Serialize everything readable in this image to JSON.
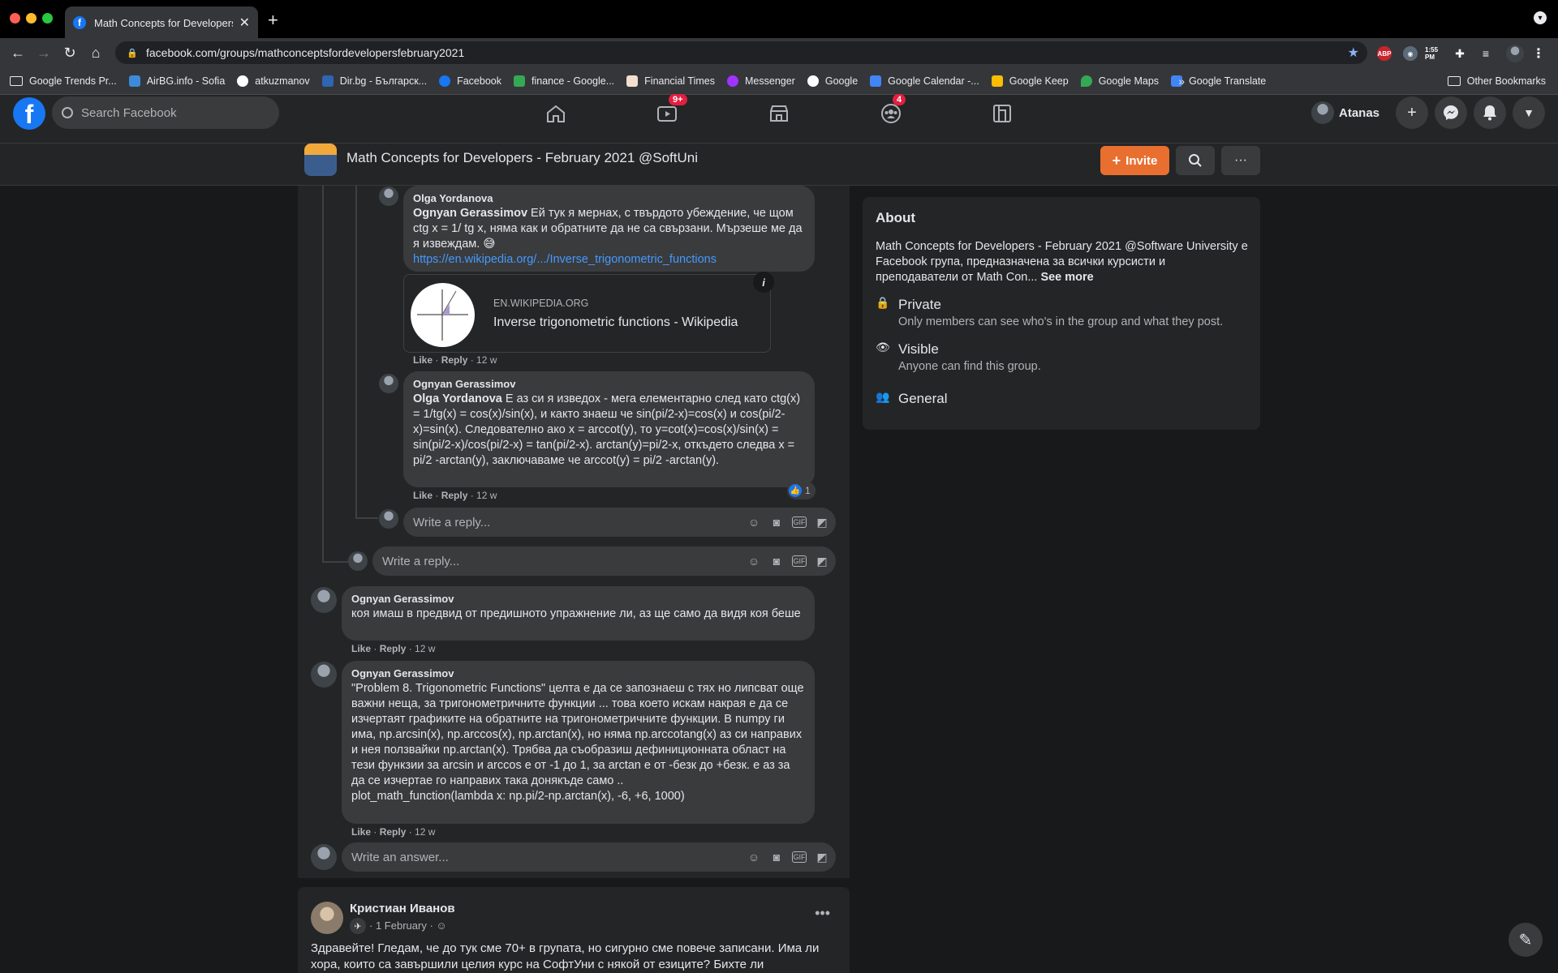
{
  "browser": {
    "tab_title": "Math Concepts for Developers",
    "url": "facebook.com/groups/mathconceptsfordevelopersfebruary2021",
    "clock": "1:55 PM",
    "bookmarks": [
      {
        "label": "Google Trends Pr...",
        "color": "#f4b400"
      },
      {
        "label": "AirBG.info - Sofia",
        "color": "#3b8bd8"
      },
      {
        "label": "atkuzmanov",
        "color": "#ffffff"
      },
      {
        "label": "Dir.bg - Българск...",
        "color": "#2f66b3"
      },
      {
        "label": "Facebook",
        "color": "#1877f2"
      },
      {
        "label": "finance - Google...",
        "color": "#34a853"
      },
      {
        "label": "Financial Times",
        "color": "#f2dfce"
      },
      {
        "label": "Messenger",
        "color": "#a033ff"
      },
      {
        "label": "Google",
        "color": "#ffffff"
      },
      {
        "label": "Google Calendar -...",
        "color": "#4285f4"
      },
      {
        "label": "Google Keep",
        "color": "#fbbc04"
      },
      {
        "label": "Google Maps",
        "color": "#34a853"
      },
      {
        "label": "Google Translate",
        "color": "#4285f4"
      }
    ],
    "more": "»",
    "other_bookmarks": "Other Bookmarks"
  },
  "fb": {
    "search_placeholder": "Search Facebook",
    "watch_badge": "9+",
    "groups_badge": "4",
    "profile_name": "Atanas"
  },
  "group": {
    "title": "Math Concepts for Developers - February 2021 @SoftUni",
    "invite_label": "Invite",
    "more_label": "···"
  },
  "comments": {
    "olga": {
      "author": "Olga Yordanova",
      "mention": "Ognyan Gerassimov",
      "text": " Ей тук я мернах, с твърдото убеждение, че щом ctg x = 1/ tg x, няма как и обратните да не са свързани. Мързеше ме да я извеждам. 😅",
      "link": "https://en.wikipedia.org/.../Inverse_trigonometric_functions",
      "preview_domain": "EN.WIKIPEDIA.ORG",
      "preview_title": "Inverse trigonometric functions - Wikipedia",
      "like": "Like",
      "reply": "Reply",
      "time": "12 w"
    },
    "ognyan1": {
      "author": "Ognyan Gerassimov",
      "mention": "Olga Yordanova",
      "text": " Е аз си я изведох - мега елементарно след като ctg(x) = 1/tg(x) = cos(x)/sin(x), и както знаеш че sin(pi/2-x)=cos(x) и cos(pi/2-x)=sin(x). Следователно ако x = arccot(y), то y=cot(x)=cos(x)/sin(x) = sin(pi/2-x)/cos(pi/2-x) = tan(pi/2-x). arctan(y)=pi/2-x, откъдето следва x = pi/2 -arctan(y), заключаваме че arccot(y) = pi/2 -arctan(y).",
      "like": "Like",
      "reply": "Reply",
      "time": "12 w",
      "reactions": "1"
    },
    "reply_placeholder": "Write a reply...",
    "ognyan2": {
      "author": "Ognyan Gerassimov",
      "text": "коя имаш в предвид от предишното упражнение ли, аз ще само да видя коя беше",
      "like": "Like",
      "reply": "Reply",
      "time": "12 w"
    },
    "ognyan3": {
      "author": "Ognyan Gerassimov",
      "text": "\"Problem 8. Trigonometric Functions\" целта е да се запознаеш с тях но липсват още важни неща, за тригонометричните функции ... това което искам накрая е да се изчертаят графиките на обратните на тригонометричните функции. В numpy ги има, np.arcsin(x), np.arccos(x), np.arctan(x), но няма np.arccotang(x) аз си направих и нея ползвайки np.arctan(x). Трябва да съобразиш дефиниционната област на тези функзии за arcsin и arccos е от -1 до 1, за arctan е от -безк до +безк. е аз за да се изчертае го направих така донякъде само ..\nplot_math_function(lambda x: np.pi/2-np.arctan(x), -6, +6, 1000)",
      "like": "Like",
      "reply": "Reply",
      "time": "12 w"
    },
    "answer_placeholder": "Write an answer..."
  },
  "post": {
    "author": "Кристиан Иванов",
    "date": "1 February",
    "text": "Здравейте! Гледам, че до тук сме 70+ в групата, но сигурно сме повече записани. Има ли хора, които са завършили целия курс на СофтУни с някой от езиците? Бихте ли"
  },
  "about": {
    "title": "About",
    "description": "Math Concepts for Developers - February 2021 @Software University е Facebook група, предназначена за всички курсисти и преподаватели от Math Con...",
    "see_more": "See more",
    "private_title": "Private",
    "private_desc": "Only members can see who's in the group and what they post.",
    "visible_title": "Visible",
    "visible_desc": "Anyone can find this group.",
    "general": "General"
  }
}
